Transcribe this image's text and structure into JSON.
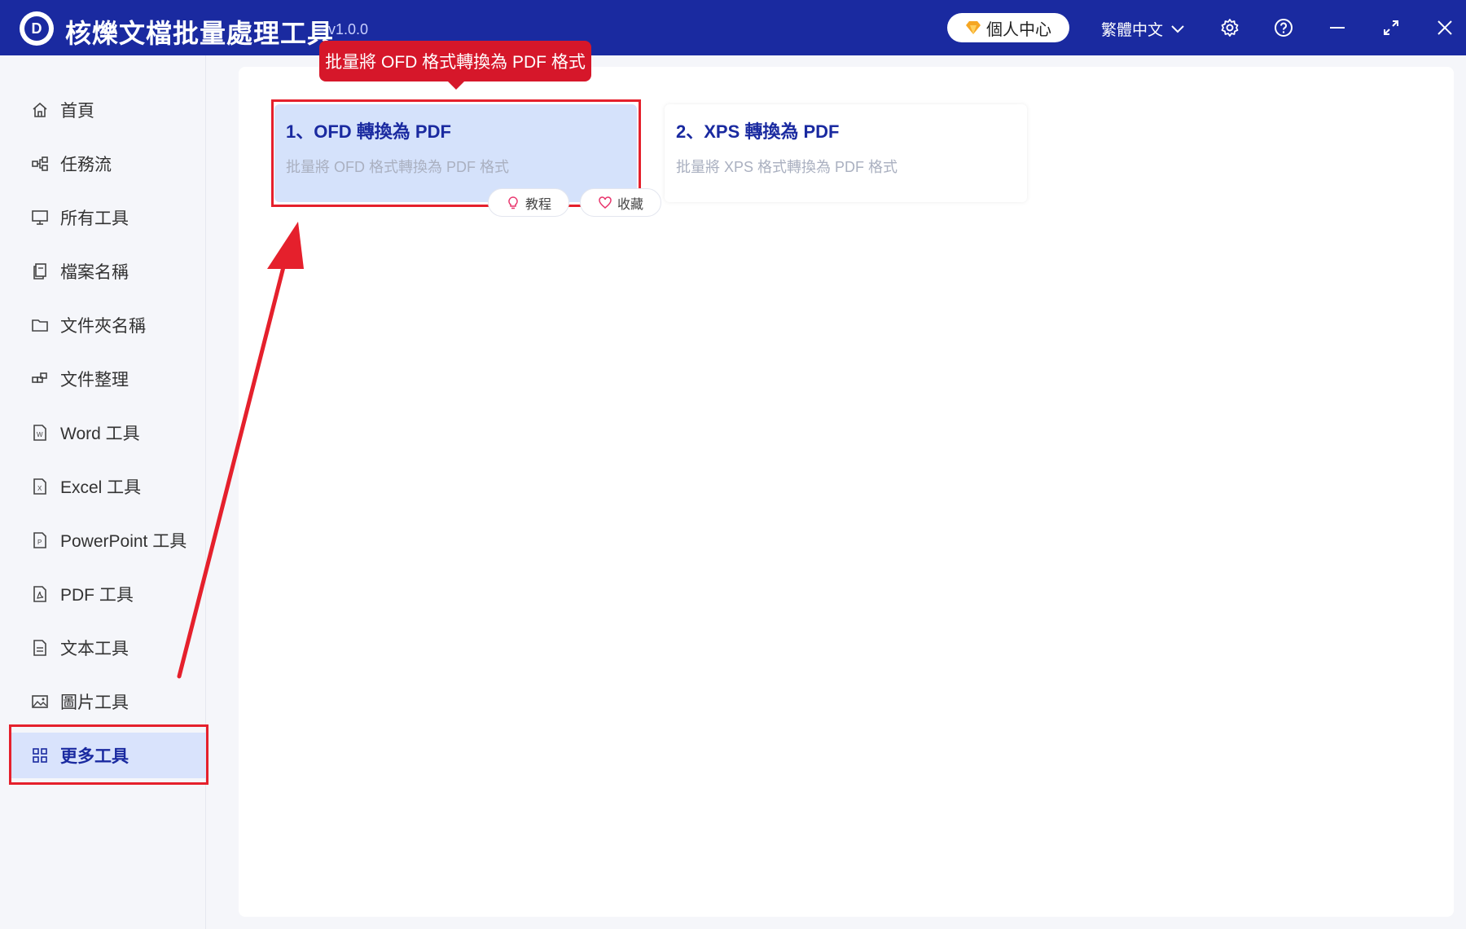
{
  "app": {
    "title": "核爍文檔批量處理工具",
    "version": "- v1.0.0",
    "logo_letter": "D",
    "user_center": "個人中心",
    "language": "繁體中文"
  },
  "sidebar": {
    "items": [
      {
        "label": "首頁",
        "icon": "home-icon"
      },
      {
        "label": "任務流",
        "icon": "workflow-icon"
      },
      {
        "label": "所有工具",
        "icon": "monitor-icon"
      },
      {
        "label": "檔案名稱",
        "icon": "file-copy-icon"
      },
      {
        "label": "文件夾名稱",
        "icon": "folder-icon"
      },
      {
        "label": "文件整理",
        "icon": "organize-icon"
      },
      {
        "label": "Word 工具",
        "icon": "word-icon"
      },
      {
        "label": "Excel 工具",
        "icon": "excel-icon"
      },
      {
        "label": "PowerPoint 工具",
        "icon": "powerpoint-icon"
      },
      {
        "label": "PDF 工具",
        "icon": "pdf-icon"
      },
      {
        "label": "文本工具",
        "icon": "text-icon"
      },
      {
        "label": "圖片工具",
        "icon": "image-icon"
      },
      {
        "label": "更多工具",
        "icon": "grid-icon",
        "active": true
      }
    ]
  },
  "tooltip": "批量將 OFD 格式轉換為 PDF 格式",
  "cards": [
    {
      "title": "1、OFD 轉換為 PDF",
      "desc": "批量將 OFD 格式轉換為 PDF 格式"
    },
    {
      "title": "2、XPS 轉換為 PDF",
      "desc": "批量將 XPS 格式轉換為 PDF 格式"
    }
  ],
  "card_actions": {
    "tutorial": "教程",
    "favorite": "收藏"
  },
  "colors": {
    "titlebar": "#1a2aa0",
    "accent": "#1a2aa0",
    "highlight": "#e5202c",
    "active_bg": "#d9e3fc"
  }
}
